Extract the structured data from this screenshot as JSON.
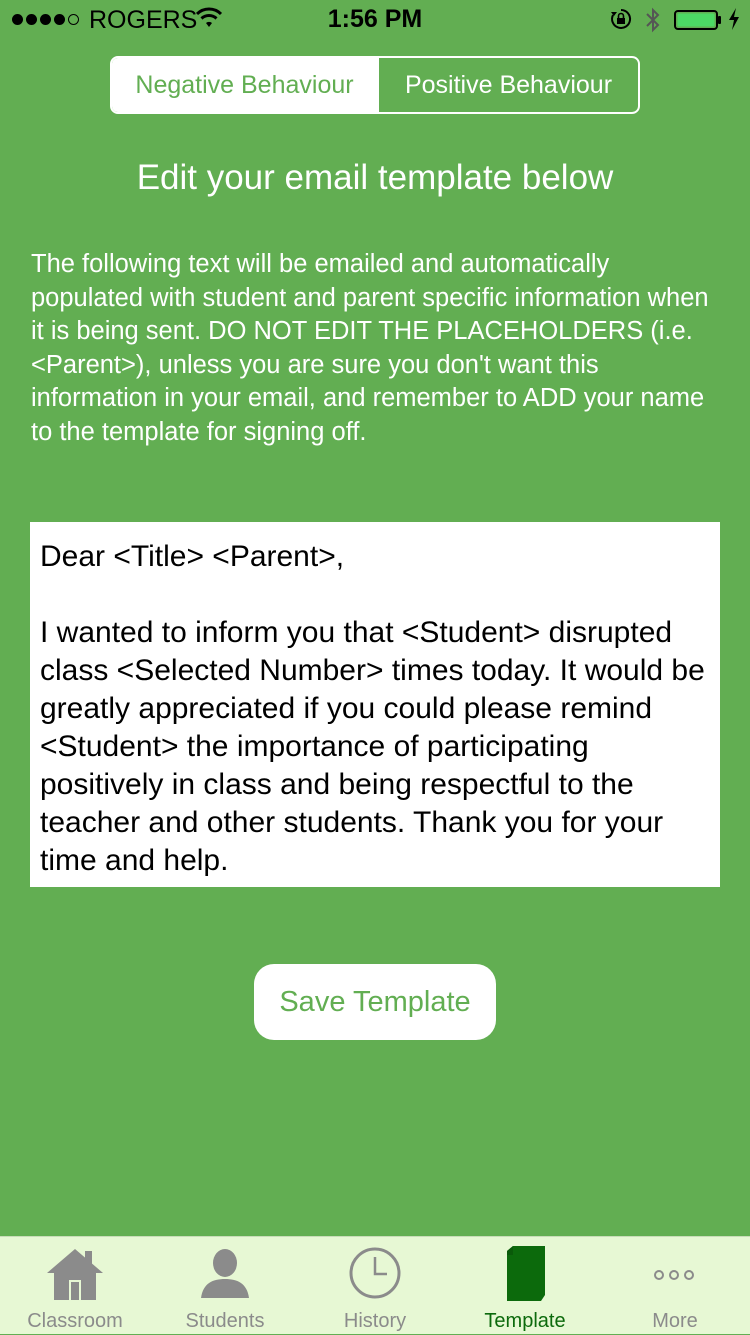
{
  "status_bar": {
    "carrier": "ROGERS",
    "time": "1:56 PM"
  },
  "segmented_control": {
    "negative_label": "Negative Behaviour",
    "positive_label": "Positive Behaviour",
    "selected": "negative"
  },
  "heading": "Edit your email template below",
  "intro_text": "The following text will be emailed and automatically populated with student and parent specific information when it is being sent. DO NOT EDIT THE PLACEHOLDERS (i.e. <Parent>), unless you are sure you don't want this information in your email, and remember to ADD your name to the template for signing off.",
  "email_template": "Dear <Title> <Parent>,\n\nI wanted to inform you that <Student> disrupted class <Selected Number> times today. It would be greatly appreciated if you could please remind <Student> the importance of participating positively in class and being respectful to the teacher and other students. Thank you for your time and help.",
  "save_button_label": "Save Template",
  "tab_bar": {
    "tabs": [
      {
        "label": "Classroom",
        "icon": "house-icon"
      },
      {
        "label": "Students",
        "icon": "person-icon"
      },
      {
        "label": "History",
        "icon": "clock-icon"
      },
      {
        "label": "Template",
        "icon": "document-icon"
      },
      {
        "label": "More",
        "icon": "more-dots-icon"
      }
    ],
    "active_index": 3
  },
  "colors": {
    "background": "#62ae52",
    "tab_bar_background": "#e7f8d4",
    "active_tab": "#0c6a0c",
    "inactive_tab": "#8b8b8b"
  }
}
